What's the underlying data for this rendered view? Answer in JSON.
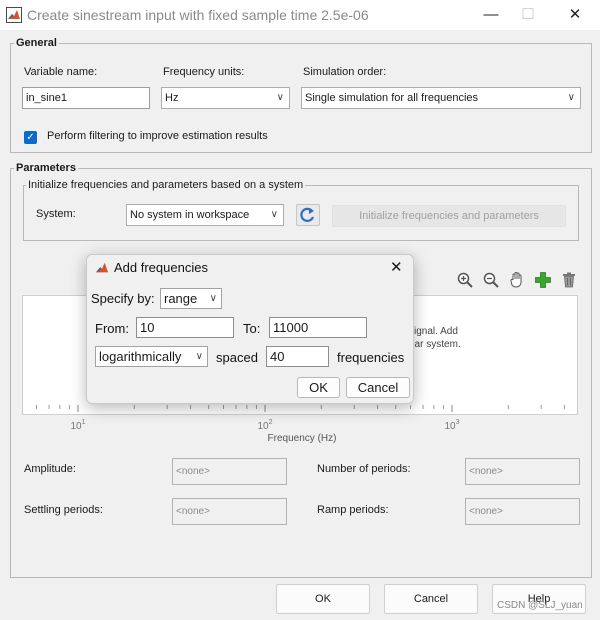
{
  "window": {
    "title": "Create sinestream input with fixed sample time 2.5e-06",
    "minimize": "—",
    "maximize": "☐",
    "close": "✕"
  },
  "general": {
    "group_label": "General",
    "variable_name_label": "Variable name:",
    "variable_name_value": "in_sine1",
    "frequency_units_label": "Frequency units:",
    "frequency_units_value": "Hz",
    "simulation_order_label": "Simulation order:",
    "simulation_order_value": "Single simulation for all frequencies",
    "filtering_label": "Perform filtering to improve estimation results",
    "filtering_checked": true
  },
  "parameters": {
    "group_label": "Parameters",
    "init_group_label": "Initialize frequencies and parameters based on a system",
    "system_label": "System:",
    "system_value": "No system in workspace",
    "initialize_button": "Initialize frequencies and parameters",
    "plot_hint_line1": "signal. Add",
    "plot_hint_line2": "ear system.",
    "amplitude_label": "Amplitude:",
    "amplitude_value": "<none>",
    "num_periods_label": "Number of periods:",
    "num_periods_value": "<none>",
    "settling_label": "Settling periods:",
    "settling_value": "<none>",
    "ramp_label": "Ramp periods:",
    "ramp_value": "<none>"
  },
  "chart_data": {
    "type": "scatter",
    "xscale": "log",
    "xlabel": "Frequency (Hz)",
    "xticks": [
      {
        "base": "10",
        "exp": "1"
      },
      {
        "base": "10",
        "exp": "2"
      },
      {
        "base": "10",
        "exp": "3"
      }
    ],
    "series": []
  },
  "footer": {
    "ok": "OK",
    "cancel": "Cancel",
    "help": "Help",
    "watermark": "CSDN @SLJ_yuan"
  },
  "dialog": {
    "title": "Add frequencies",
    "close": "✕",
    "specify_label": "Specify by:",
    "specify_value": "range",
    "from_label": "From:",
    "from_value": "10",
    "to_label": "To:",
    "to_value": "11000",
    "spacing_value": "logarithmically",
    "spaced_label": "spaced",
    "count_value": "40",
    "frequencies_label": "frequencies",
    "ok": "OK",
    "cancel": "Cancel"
  },
  "colors": {
    "accent": "#0b6acb",
    "matlab_logo": "#d9531e"
  }
}
